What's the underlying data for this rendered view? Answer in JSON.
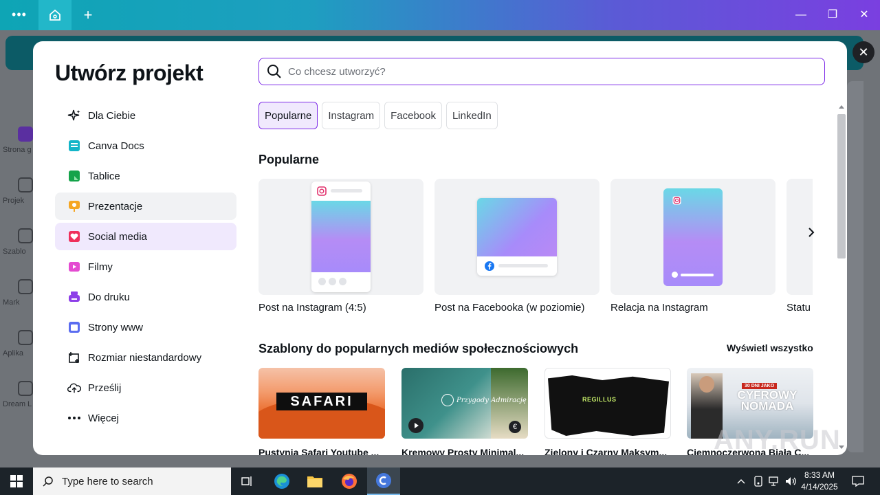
{
  "titlebar": {
    "dots": "•••",
    "plus": "+",
    "minimize": "—",
    "maximize": "❐",
    "close": "✕"
  },
  "app_sidebar": [
    {
      "label": "Strona g"
    },
    {
      "label": "Projek"
    },
    {
      "label": "Szablo"
    },
    {
      "label": "Mark"
    },
    {
      "label": "Aplika"
    },
    {
      "label": "Dream L"
    }
  ],
  "modal": {
    "title": "Utwórz projekt",
    "close": "✕",
    "search": {
      "placeholder": "Co chcesz utworzyć?",
      "value": ""
    },
    "nav": [
      {
        "label": "Dla Ciebie",
        "icon": "sparkles-icon"
      },
      {
        "label": "Canva Docs",
        "icon": "docs-icon"
      },
      {
        "label": "Tablice",
        "icon": "whiteboard-icon"
      },
      {
        "label": "Prezentacje",
        "icon": "presentation-icon"
      },
      {
        "label": "Social media",
        "icon": "heart-icon"
      },
      {
        "label": "Filmy",
        "icon": "video-icon"
      },
      {
        "label": "Do druku",
        "icon": "print-icon"
      },
      {
        "label": "Strony www",
        "icon": "website-icon"
      },
      {
        "label": "Rozmiar niestandardowy",
        "icon": "custom-size-icon"
      },
      {
        "label": "Prześlij",
        "icon": "upload-cloud-icon"
      },
      {
        "label": "Więcej",
        "icon": "more-icon"
      }
    ],
    "chips": [
      "Popularne",
      "Instagram",
      "Facebook",
      "LinkedIn"
    ],
    "popular": {
      "title": "Popularne",
      "cards": [
        {
          "label": "Post na Instagram (4:5)"
        },
        {
          "label": "Post na Facebooka (w poziomie)"
        },
        {
          "label": "Relacja na Instagram"
        },
        {
          "label": "Statu"
        }
      ]
    },
    "templates": {
      "title": "Szablony do popularnych mediów społecznościowych",
      "view_all": "Wyświetl wszystko",
      "items": [
        {
          "label": "Pustynia Safari Youtube ...",
          "thumb_text": "SAFARI"
        },
        {
          "label": "Kremowy Prosty Minimal...",
          "thumb_text": "Przygody Admirację"
        },
        {
          "label": "Zielony i Czarny Maksym...",
          "thumb_text": "REGILLUS"
        },
        {
          "label": "Ciemnoczerwona Biała C...",
          "thumb_text": "CYFROWY NOMADA",
          "thumb_badge": "30 DNI JAKO"
        }
      ]
    }
  },
  "watermark": "ANY.RUN",
  "taskbar": {
    "search_placeholder": "Type here to search",
    "time": "8:33 AM",
    "date": "4/14/2025"
  },
  "colors": {
    "accent": "#7d2ae8",
    "titlebar_start": "#0ea5b5",
    "titlebar_end": "#7a3fe0"
  }
}
